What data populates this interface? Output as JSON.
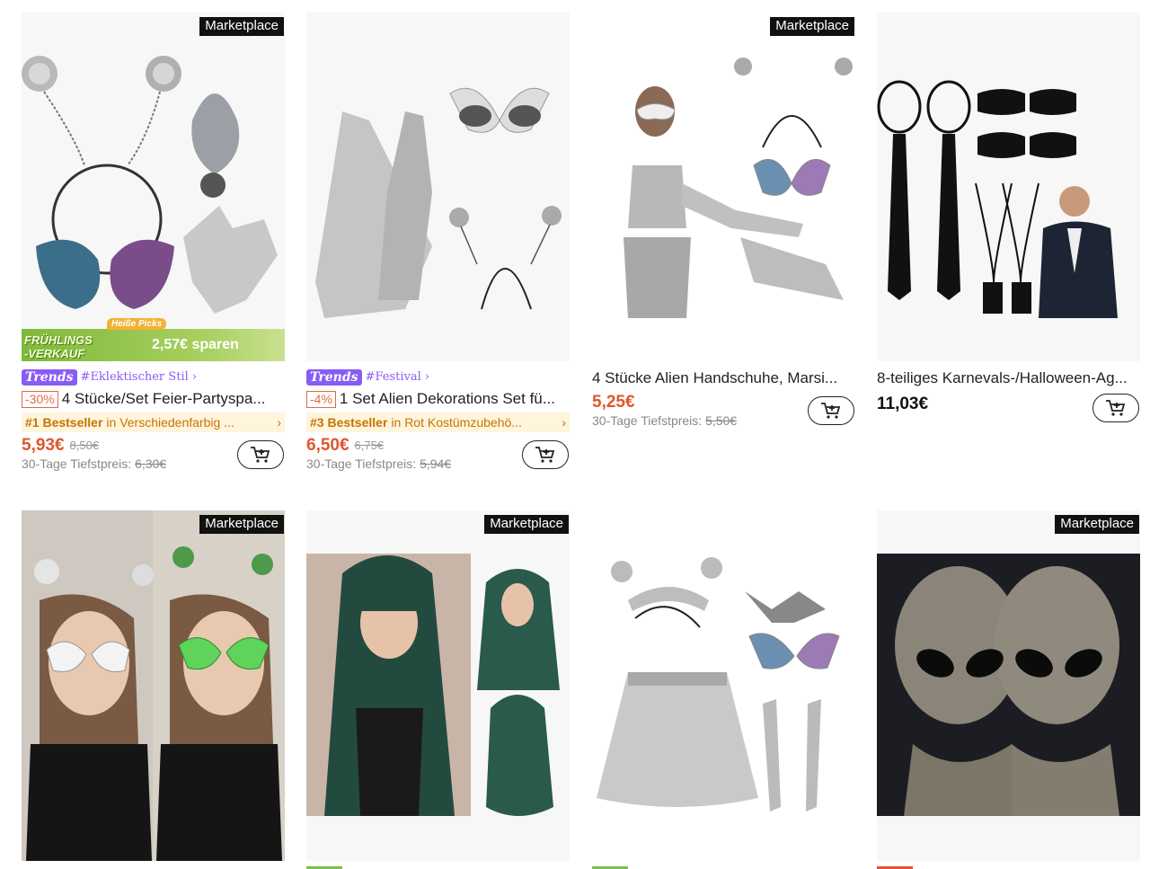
{
  "products": [
    {
      "marketplace": "Marketplace",
      "promo": {
        "label_line1": "FRÜHLINGS",
        "label_line2": "-VERKAUF",
        "hot": "Heiße Picks",
        "savings": "2,57€ sparen"
      },
      "trends_logo": "Trends",
      "trends_tag": "#Eklektischer Stil ›",
      "discount": "-30%",
      "title": "4 Stücke/Set Feier-Partyspa...",
      "bestseller": "#1 Bestseller",
      "best_category": "in Verschiedenfarbig ...",
      "price": "5,93€",
      "old_price": "8,50€",
      "lowest_label": "30-Tage Tiefstpreis:",
      "lowest_value": "6,30€"
    },
    {
      "trends_logo": "Trends",
      "trends_tag": "#Festival ›",
      "discount": "-4%",
      "title": "1 Set Alien Dekorations Set fü...",
      "bestseller": "#3 Bestseller",
      "best_category": "in Rot Kostümzubehö...",
      "price": "6,50€",
      "old_price": "6,75€",
      "lowest_label": "30-Tage Tiefstpreis:",
      "lowest_value": "5,94€"
    },
    {
      "marketplace": "Marketplace",
      "title": "4 Stücke Alien Handschuhe, Marsi...",
      "price": "5,25€",
      "lowest_label": "30-Tage Tiefstpreis:",
      "lowest_value": "5,50€"
    },
    {
      "title": "8-teiliges Karnevals-/Halloween-Ag...",
      "price": "11,03€"
    },
    {
      "marketplace": "Marketplace"
    },
    {
      "marketplace": "Marketplace"
    },
    {},
    {
      "marketplace": "Marketplace"
    }
  ],
  "colors": {
    "accent_price": "#e0562f",
    "trends": "#8a5cf6",
    "bestseller_bg": "#fff4dc",
    "promo_green": "#8cc63f"
  },
  "icons": {
    "cart": "add-to-cart-icon"
  }
}
